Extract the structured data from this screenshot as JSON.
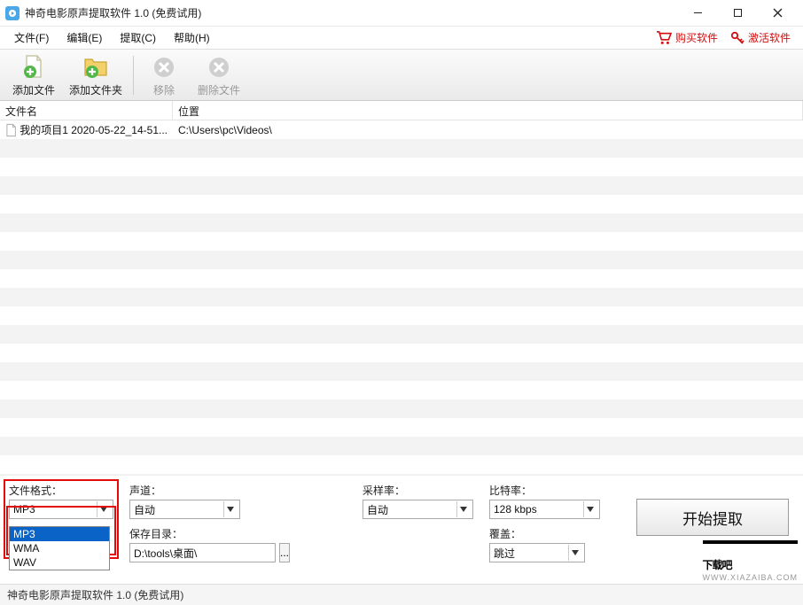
{
  "title_bar": {
    "title": "神奇电影原声提取软件 1.0 (免费试用)"
  },
  "window_controls": {
    "minimize": "minimize",
    "maximize": "maximize",
    "close": "close"
  },
  "menu": {
    "file": "文件(F)",
    "edit": "编辑(E)",
    "extract": "提取(C)",
    "help": "帮助(H)",
    "buy": "购买软件",
    "activate": "激活软件"
  },
  "toolbar": {
    "add_file": "添加文件",
    "add_folder": "添加文件夹",
    "remove": "移除",
    "remove_file": "删除文件"
  },
  "table": {
    "headers": {
      "filename": "文件名",
      "location": "位置"
    },
    "rows": [
      {
        "filename": "我的项目1 2020-05-22_14-51...",
        "location": "C:\\Users\\pc\\Videos\\"
      }
    ]
  },
  "settings": {
    "file_format": {
      "label": "文件格式：",
      "value": "MP3",
      "options": [
        "MP3",
        "WMA",
        "WAV"
      ]
    },
    "channel": {
      "label": "声道：",
      "value": "自动"
    },
    "sample_rate": {
      "label": "采样率：",
      "value": "自动"
    },
    "bitrate": {
      "label": "比特率：",
      "value": "128 kbps"
    },
    "save_dir": {
      "label": "保存目录：",
      "value": "D:\\tools\\桌面\\",
      "browse": "..."
    },
    "overwrite": {
      "label": "覆盖：",
      "value": "跳过"
    },
    "start": "开始提取"
  },
  "status": {
    "text": "神奇电影原声提取软件 1.0 (免费试用)"
  },
  "watermark": {
    "text": "下载吧",
    "sub": "WWW.XIAZAIBA.COM"
  }
}
